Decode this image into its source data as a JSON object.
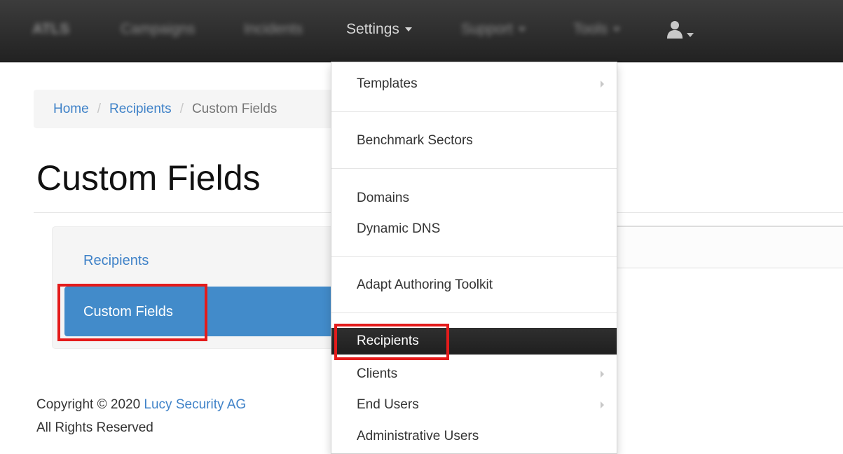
{
  "navbar": {
    "brand": "ATLS",
    "items": [
      "Campaigns",
      "Incidents",
      "Settings",
      "Support",
      "Tools"
    ],
    "user_icon": "user-icon"
  },
  "breadcrumb": {
    "home": "Home",
    "separator": "/",
    "recipients": "Recipients",
    "current": "Custom Fields"
  },
  "page": {
    "title": "Custom Fields"
  },
  "side_nav": {
    "items": [
      "Recipients",
      "Custom Fields"
    ],
    "active": "Custom Fields"
  },
  "footer": {
    "copyright": "Copyright © 2020",
    "company": "Lucy Security AG",
    "rights": "All Rights Reserved"
  },
  "settings_menu": {
    "items": [
      "Templates",
      "Benchmark Sectors",
      "Domains",
      "Dynamic DNS",
      "Adapt Authoring Toolkit",
      "Recipients",
      "Clients",
      "End Users",
      "Administrative Users"
    ],
    "active": "Recipients"
  },
  "colors": {
    "navbar": "#222222",
    "link": "#3f82c8",
    "active_nav": "#428bca",
    "highlight": "#e41b1b"
  }
}
